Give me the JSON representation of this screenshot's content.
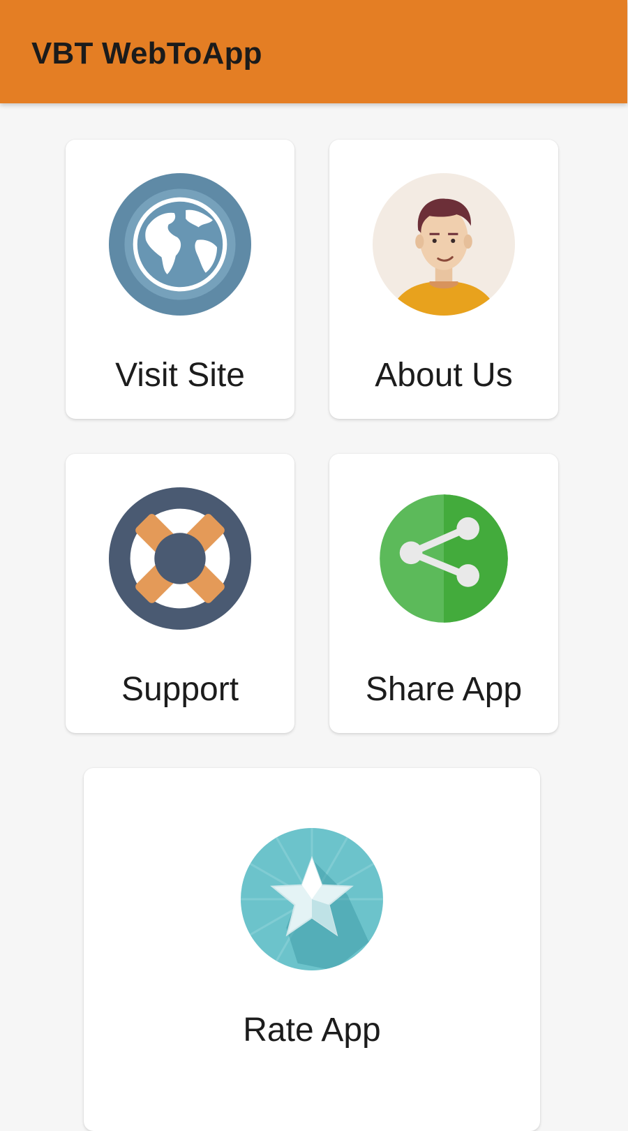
{
  "app_bar": {
    "title": "VBT WebToApp",
    "color": "#e47e24"
  },
  "tiles": [
    {
      "label": "Visit Site",
      "icon": "globe-icon"
    },
    {
      "label": "About Us",
      "icon": "person-avatar-icon"
    },
    {
      "label": "Support",
      "icon": "lifebuoy-icon"
    },
    {
      "label": "Share App",
      "icon": "share-icon"
    },
    {
      "label": "Rate App",
      "icon": "star-icon"
    }
  ]
}
